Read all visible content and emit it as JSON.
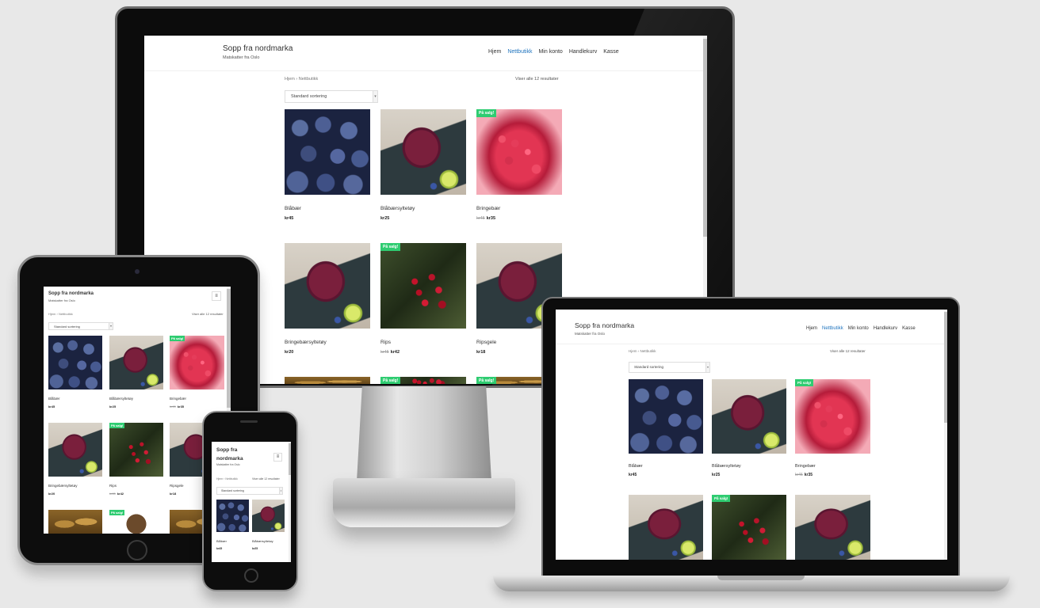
{
  "site": {
    "title": "Sopp fra nordmarka",
    "tagline": "Matskatter fra Oslo"
  },
  "nav": [
    "Hjem",
    "Nettbutikk",
    "Min konto",
    "Handlekurv",
    "Kasse"
  ],
  "nav_active": "Nettbutikk",
  "breadcrumb": {
    "home": "Hjem",
    "sep": "›",
    "current": "Nettbutikk"
  },
  "result_count_12": "Viser alle 12 resultater",
  "result_count_ipad": "Viser alle 12 resultater",
  "result_count_phone": "Viser alle 12 resultater",
  "sort_label": "Standard sortering",
  "sale_badge": "På salg!",
  "currency": "kr",
  "products": [
    {
      "name": "Blåbær",
      "price": "kr45",
      "old_price": "",
      "sale": false,
      "image": "blueberries"
    },
    {
      "name": "Blåbærsyltetøy",
      "price": "kr25",
      "old_price": "",
      "sale": false,
      "image": "jam-jar"
    },
    {
      "name": "Bringebær",
      "price": "kr35",
      "old_price": "kr45",
      "sale": true,
      "image": "raspberries"
    },
    {
      "name": "Bringebærsyltetøy",
      "price": "kr20",
      "old_price": "",
      "sale": false,
      "image": "jam-jar"
    },
    {
      "name": "Rips",
      "price": "kr42",
      "old_price": "kr45",
      "sale": true,
      "image": "redcurrants"
    },
    {
      "name": "Ripsgele",
      "price": "kr18",
      "old_price": "",
      "sale": false,
      "image": "jam-jar"
    }
  ],
  "colors": {
    "accent": "#1e73be",
    "sale": "#2fcc71",
    "background": "#e8e8e8",
    "device_bezel": "#0c0c0c"
  }
}
